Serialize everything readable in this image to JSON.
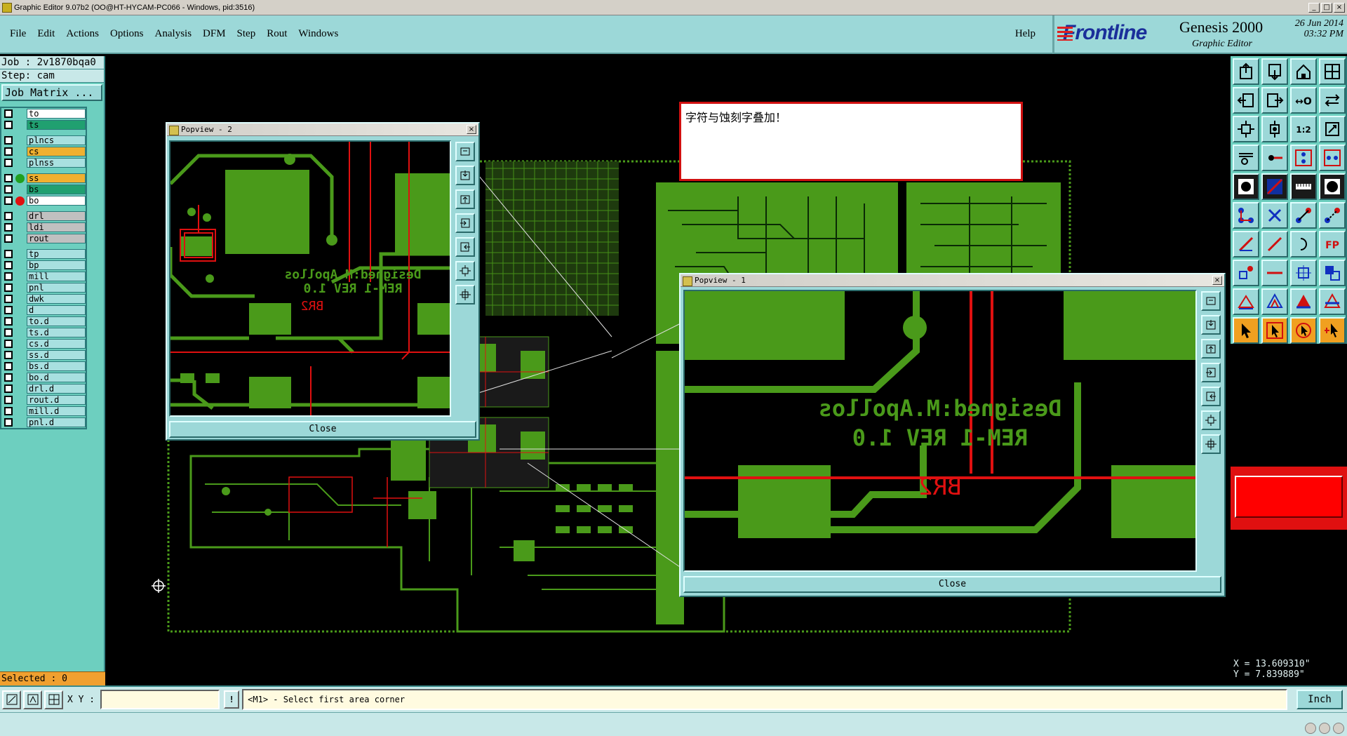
{
  "window": {
    "title": "Graphic Editor 9.07b2 (OO@HT-HYCAM-PC066 - Windows, pid:3516)"
  },
  "menu": {
    "items": [
      "File",
      "Edit",
      "Actions",
      "Options",
      "Analysis",
      "DFM",
      "Step",
      "Rout",
      "Windows"
    ],
    "help": "Help"
  },
  "brand": {
    "logo": "Frontline",
    "product": "Genesis 2000",
    "subtitle": "Graphic Editor",
    "date": "26 Jun 2014",
    "time": "03:32 PM"
  },
  "job": {
    "job": "Job : 2v1870bqa0",
    "step": "Step: cam",
    "matrix_button": "Job Matrix ..."
  },
  "layers": [
    {
      "name": "to",
      "style": "white",
      "marker": "box"
    },
    {
      "name": "ts",
      "style": "green",
      "marker": "box"
    },
    {
      "name": "gap"
    },
    {
      "name": "plncs",
      "style": "plain",
      "marker": "box"
    },
    {
      "name": "cs",
      "style": "orange",
      "marker": "box"
    },
    {
      "name": "plnss",
      "style": "plain",
      "marker": "box"
    },
    {
      "name": "gap"
    },
    {
      "name": "ss",
      "style": "orange",
      "marker": "green-dot"
    },
    {
      "name": "bs",
      "style": "green",
      "marker": "box"
    },
    {
      "name": "bo",
      "style": "white",
      "marker": "red-dot"
    },
    {
      "name": "gap"
    },
    {
      "name": "drl",
      "style": "gray",
      "marker": "box"
    },
    {
      "name": "ldi",
      "style": "gray",
      "marker": "box"
    },
    {
      "name": "rout",
      "style": "gray",
      "marker": "box"
    },
    {
      "name": "gap"
    },
    {
      "name": "tp",
      "style": "plain",
      "marker": "box"
    },
    {
      "name": "bp",
      "style": "plain",
      "marker": "box"
    },
    {
      "name": "mill",
      "style": "plain",
      "marker": "box"
    },
    {
      "name": "pnl",
      "style": "plain",
      "marker": "box"
    },
    {
      "name": "dwk",
      "style": "plain",
      "marker": "box"
    },
    {
      "name": "d",
      "style": "plain",
      "marker": "box"
    },
    {
      "name": "to.d",
      "style": "plain",
      "marker": "box"
    },
    {
      "name": "ts.d",
      "style": "plain",
      "marker": "box"
    },
    {
      "name": "cs.d",
      "style": "plain",
      "marker": "box"
    },
    {
      "name": "ss.d",
      "style": "plain",
      "marker": "box"
    },
    {
      "name": "bs.d",
      "style": "plain",
      "marker": "box"
    },
    {
      "name": "bo.d",
      "style": "plain",
      "marker": "box"
    },
    {
      "name": "drl.d",
      "style": "plain",
      "marker": "box"
    },
    {
      "name": "rout.d",
      "style": "plain",
      "marker": "box"
    },
    {
      "name": "mill.d",
      "style": "plain",
      "marker": "box"
    },
    {
      "name": "pnl.d",
      "style": "plain",
      "marker": "box"
    }
  ],
  "selected": "Selected : 0",
  "message": "字符与蚀刻字叠加！",
  "popview2": {
    "title": "Popview - 2",
    "close": "Close",
    "silk_text_1": "Designed:M.Apollos",
    "silk_text_2": "REM-1 REV 1.0",
    "ref": "BR2"
  },
  "popview1": {
    "title": "Popview - 1",
    "close": "Close",
    "silk_text_1": "Designed:M.Apollos",
    "silk_text_2": "REM-1 REV 1.0",
    "ref": "BR2"
  },
  "coords": {
    "x": "X = 13.609310\"",
    "y": "Y = 7.839889\""
  },
  "status": {
    "xy_label": "X Y :",
    "xy_value": "",
    "prompt": "<M1> - Select first area corner",
    "unit": "Inch"
  },
  "colors": {
    "panel": "#6dcfbf",
    "menu": "#9cd8d8",
    "copper": "#4a9a1a",
    "silk": "#e01010",
    "accent_red": "#ff0000"
  }
}
